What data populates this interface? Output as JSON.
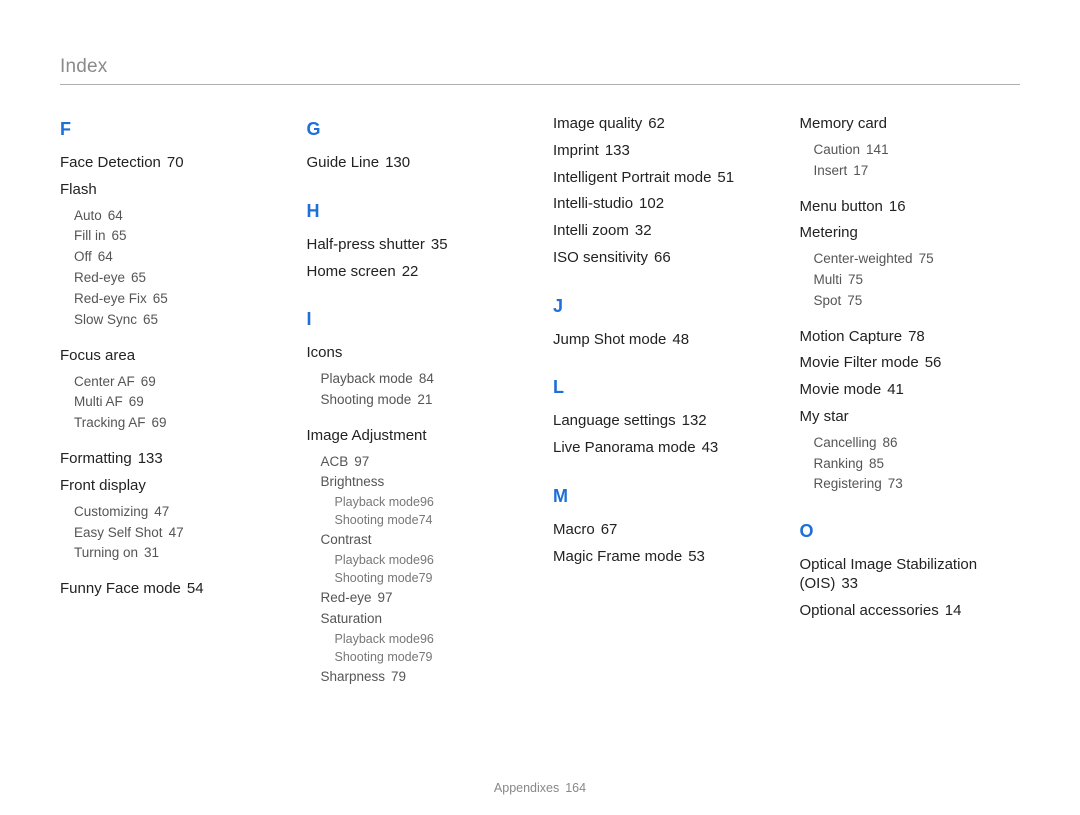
{
  "header": {
    "title": "Index"
  },
  "footer": {
    "section": "Appendixes",
    "page": "164"
  },
  "sections": {
    "F": {
      "letter": "F",
      "face_detection": {
        "label": "Face Detection",
        "page": "70"
      },
      "flash": {
        "label": "Flash",
        "auto": {
          "label": "Auto",
          "page": "64"
        },
        "fill_in": {
          "label": "Fill in",
          "page": "65"
        },
        "off": {
          "label": "Off",
          "page": "64"
        },
        "red_eye": {
          "label": "Red-eye",
          "page": "65"
        },
        "red_eye_fix": {
          "label": "Red-eye Fix",
          "page": "65"
        },
        "slow_sync": {
          "label": "Slow Sync",
          "page": "65"
        }
      },
      "focus_area": {
        "label": "Focus area",
        "center_af": {
          "label": "Center AF",
          "page": "69"
        },
        "multi_af": {
          "label": "Multi AF",
          "page": "69"
        },
        "tracking_af": {
          "label": "Tracking AF",
          "page": "69"
        }
      },
      "formatting": {
        "label": "Formatting",
        "page": "133"
      },
      "front_display": {
        "label": "Front display",
        "customizing": {
          "label": "Customizing",
          "page": "47"
        },
        "easy_self_shot": {
          "label": "Easy Self Shot",
          "page": "47"
        },
        "turning_on": {
          "label": "Turning on",
          "page": "31"
        }
      },
      "funny_face": {
        "label": "Funny Face mode",
        "page": "54"
      }
    },
    "G": {
      "letter": "G",
      "guide_line": {
        "label": "Guide Line",
        "page": "130"
      }
    },
    "H": {
      "letter": "H",
      "half_press": {
        "label": "Half-press shutter",
        "page": "35"
      },
      "home_screen": {
        "label": "Home screen",
        "page": "22"
      }
    },
    "I1": {
      "letter": "I",
      "icons": {
        "label": "Icons",
        "playback": {
          "label": "Playback mode",
          "page": "84"
        },
        "shooting": {
          "label": "Shooting mode",
          "page": "21"
        }
      },
      "image_adjustment": {
        "label": "Image Adjustment",
        "acb": {
          "label": "ACB",
          "page": "97"
        },
        "brightness": {
          "label": "Brightness",
          "playback": {
            "label": "Playback mode",
            "page": "96"
          },
          "shooting": {
            "label": "Shooting mode",
            "page": "74"
          }
        },
        "contrast": {
          "label": "Contrast",
          "playback": {
            "label": "Playback mode",
            "page": "96"
          },
          "shooting": {
            "label": "Shooting mode",
            "page": "79"
          }
        },
        "red_eye": {
          "label": "Red-eye",
          "page": "97"
        },
        "saturation": {
          "label": "Saturation",
          "playback": {
            "label": "Playback mode",
            "page": "96"
          },
          "shooting": {
            "label": "Shooting mode",
            "page": "79"
          }
        },
        "sharpness": {
          "label": "Sharpness",
          "page": "79"
        }
      }
    },
    "I2": {
      "image_quality": {
        "label": "Image quality",
        "page": "62"
      },
      "imprint": {
        "label": "Imprint",
        "page": "133"
      },
      "intelligent_portrait": {
        "label": "Intelligent Portrait mode",
        "page": "51"
      },
      "intelli_studio": {
        "label": "Intelli-studio",
        "page": "102"
      },
      "intelli_zoom": {
        "label": "Intelli zoom",
        "page": "32"
      },
      "iso": {
        "label": "ISO sensitivity",
        "page": "66"
      }
    },
    "J": {
      "letter": "J",
      "jump_shot": {
        "label": "Jump Shot mode",
        "page": "48"
      }
    },
    "L": {
      "letter": "L",
      "language": {
        "label": "Language settings",
        "page": "132"
      },
      "live_panorama": {
        "label": "Live Panorama mode",
        "page": "43"
      }
    },
    "M1": {
      "letter": "M",
      "macro": {
        "label": "Macro",
        "page": "67"
      },
      "magic_frame": {
        "label": "Magic Frame mode",
        "page": "53"
      }
    },
    "M2": {
      "memory_card": {
        "label": "Memory card",
        "caution": {
          "label": "Caution",
          "page": "141"
        },
        "insert": {
          "label": "Insert",
          "page": "17"
        }
      },
      "menu_button": {
        "label": "Menu button",
        "page": "16"
      },
      "metering": {
        "label": "Metering",
        "center_weighted": {
          "label": "Center-weighted",
          "page": "75"
        },
        "multi": {
          "label": "Multi",
          "page": "75"
        },
        "spot": {
          "label": "Spot",
          "page": "75"
        }
      },
      "motion_capture": {
        "label": "Motion Capture",
        "page": "78"
      },
      "movie_filter": {
        "label": "Movie Filter mode",
        "page": "56"
      },
      "movie_mode": {
        "label": "Movie mode",
        "page": "41"
      },
      "my_star": {
        "label": "My star",
        "cancelling": {
          "label": "Cancelling",
          "page": "86"
        },
        "ranking": {
          "label": "Ranking",
          "page": "85"
        },
        "registering": {
          "label": "Registering",
          "page": "73"
        }
      }
    },
    "O": {
      "letter": "O",
      "ois": {
        "label": "Optical Image Stabilization (OIS)",
        "page": "33"
      },
      "accessories": {
        "label": "Optional accessories",
        "page": "14"
      }
    }
  }
}
